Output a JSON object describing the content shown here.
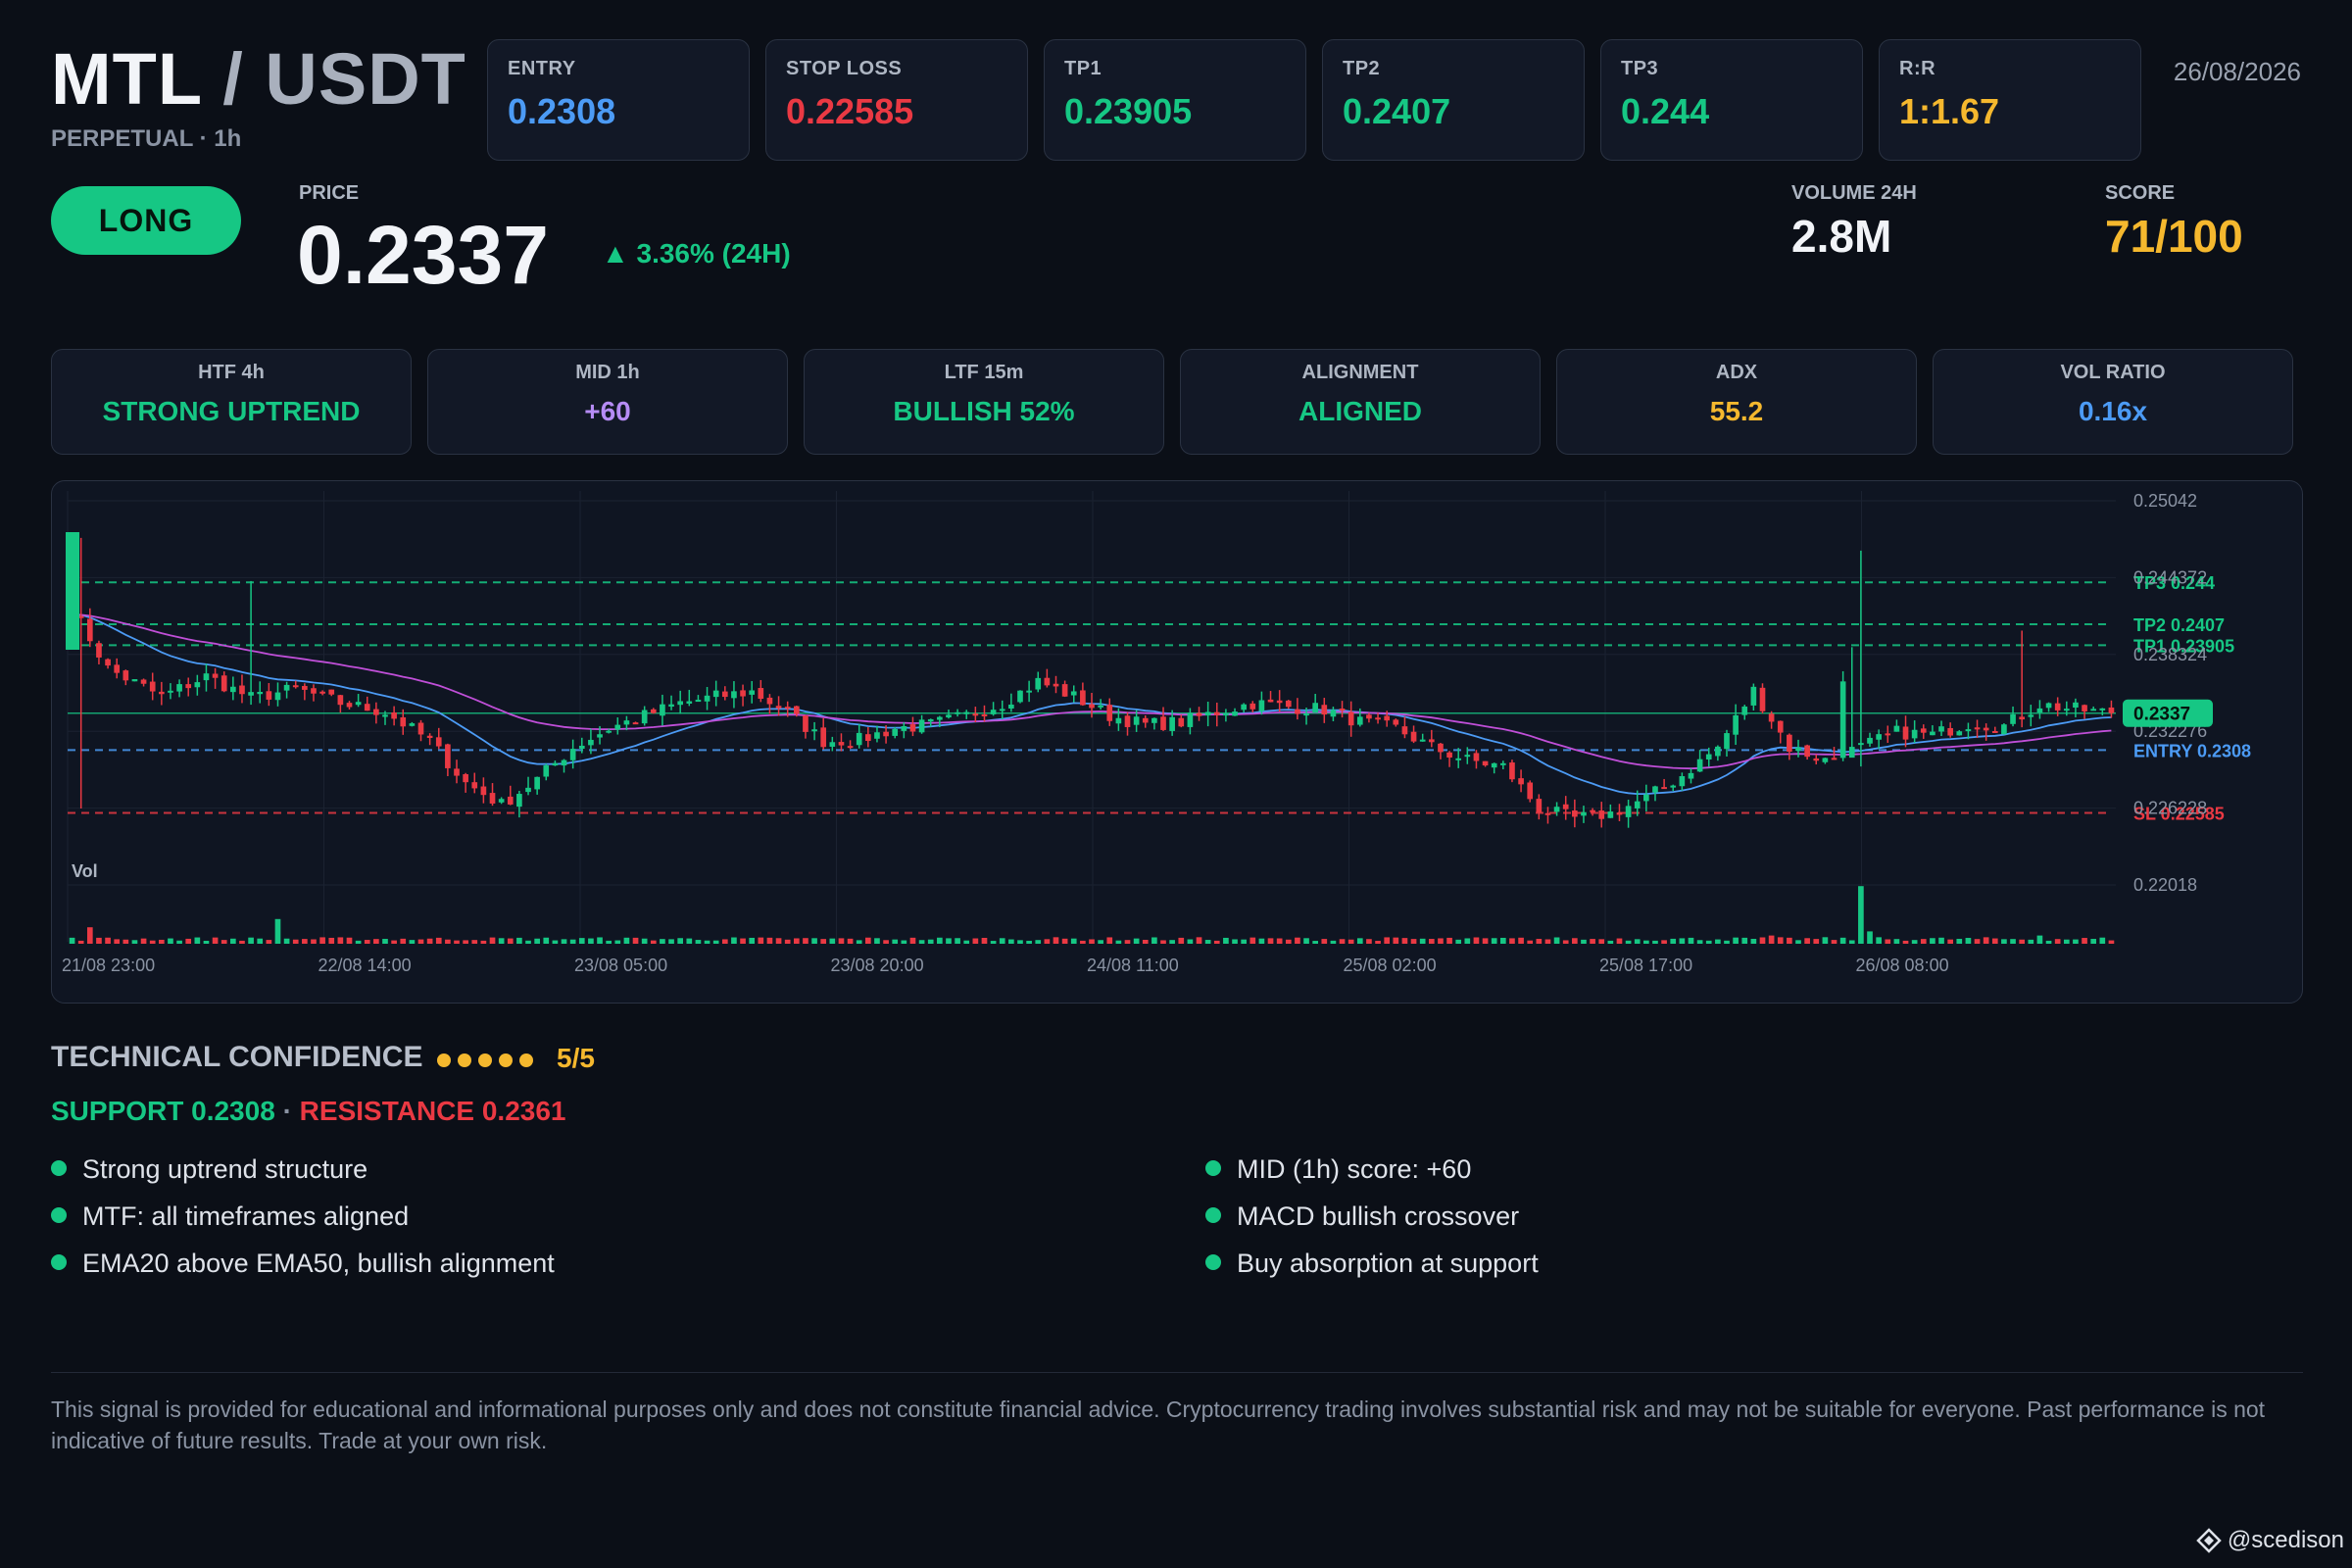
{
  "header": {
    "base": "MTL",
    "separator": "/",
    "quote": "USDT",
    "subtitle": "PERPETUAL · 1h",
    "date": "26/08/2026"
  },
  "metrics": [
    {
      "label": "ENTRY",
      "value": "0.2308",
      "color": "#4c9bf5"
    },
    {
      "label": "STOP LOSS",
      "value": "0.22585",
      "color": "#ea3943"
    },
    {
      "label": "TP1",
      "value": "0.23905",
      "color": "#16c784"
    },
    {
      "label": "TP2",
      "value": "0.2407",
      "color": "#16c784"
    },
    {
      "label": "TP3",
      "value": "0.244",
      "color": "#16c784"
    },
    {
      "label": "R:R",
      "value": "1:1.67",
      "color": "#f5b82e"
    }
  ],
  "signal": {
    "side": "LONG",
    "price_label": "PRICE",
    "price": "0.2337",
    "change": "▲ 3.36% (24H)",
    "volume_label": "VOLUME 24H",
    "volume": "2.8M",
    "score_label": "SCORE",
    "score": "71/100"
  },
  "timeframes": [
    {
      "label": "HTF 4h",
      "value": "STRONG UPTREND",
      "color": "#16c784"
    },
    {
      "label": "MID 1h",
      "value": "+60",
      "color": "#b68cf5"
    },
    {
      "label": "LTF 15m",
      "value": "BULLISH 52%",
      "color": "#16c784"
    },
    {
      "label": "ALIGNMENT",
      "value": "ALIGNED",
      "color": "#16c784"
    },
    {
      "label": "ADX",
      "value": "55.2",
      "color": "#f5b82e"
    },
    {
      "label": "VOL RATIO",
      "value": "0.16x",
      "color": "#4c9bf5"
    }
  ],
  "chart_data": {
    "type": "candlestick",
    "y_range": [
      0.22018,
      0.25042
    ],
    "y_ticks": [
      "0.25042",
      "0.244372",
      "0.238324",
      "0.232276",
      "0.226228",
      "0.22018"
    ],
    "x_ticks": [
      "21/08 23:00",
      "22/08 14:00",
      "23/08 05:00",
      "23/08 20:00",
      "24/08 11:00",
      "25/08 02:00",
      "25/08 17:00",
      "26/08 08:00"
    ],
    "volume_label": "Vol",
    "current_price_tag": "0.2337",
    "levels": [
      {
        "label": "TP3 0.244",
        "value": 0.244,
        "color": "#16c784"
      },
      {
        "label": "TP2 0.2407",
        "value": 0.2407,
        "color": "#16c784"
      },
      {
        "label": "TP1 0.23905",
        "value": 0.23905,
        "color": "#16c784"
      },
      {
        "label": "ENTRY 0.2308",
        "value": 0.2308,
        "color": "#4c9bf5"
      },
      {
        "label": "SL 0.22585",
        "value": 0.22585,
        "color": "#ea3943"
      }
    ],
    "current_price": 0.2337,
    "close_anchors": [
      [
        0,
        0.242
      ],
      [
        4,
        0.2372
      ],
      [
        10,
        0.235
      ],
      [
        15,
        0.2366
      ],
      [
        20,
        0.2349
      ],
      [
        25,
        0.2356
      ],
      [
        30,
        0.2345
      ],
      [
        35,
        0.2338
      ],
      [
        40,
        0.2315
      ],
      [
        44,
        0.2282
      ],
      [
        48,
        0.2265
      ],
      [
        52,
        0.2285
      ],
      [
        56,
        0.231
      ],
      [
        60,
        0.2325
      ],
      [
        64,
        0.2335
      ],
      [
        68,
        0.2345
      ],
      [
        72,
        0.235
      ],
      [
        76,
        0.2354
      ],
      [
        80,
        0.2338
      ],
      [
        84,
        0.2315
      ],
      [
        88,
        0.2316
      ],
      [
        92,
        0.2325
      ],
      [
        96,
        0.2328
      ],
      [
        100,
        0.2335
      ],
      [
        104,
        0.2345
      ],
      [
        108,
        0.2362
      ],
      [
        112,
        0.235
      ],
      [
        116,
        0.2335
      ],
      [
        120,
        0.2328
      ],
      [
        124,
        0.233
      ],
      [
        128,
        0.2338
      ],
      [
        132,
        0.2345
      ],
      [
        136,
        0.2342
      ],
      [
        140,
        0.234
      ],
      [
        144,
        0.233
      ],
      [
        148,
        0.2325
      ],
      [
        152,
        0.231
      ],
      [
        156,
        0.23
      ],
      [
        160,
        0.2295
      ],
      [
        164,
        0.2262
      ],
      [
        168,
        0.2254
      ],
      [
        172,
        0.2258
      ],
      [
        176,
        0.227
      ],
      [
        180,
        0.2288
      ],
      [
        184,
        0.231
      ],
      [
        188,
        0.2355
      ],
      [
        192,
        0.231
      ],
      [
        196,
        0.23
      ],
      [
        200,
        0.231
      ],
      [
        204,
        0.2322
      ],
      [
        208,
        0.232
      ],
      [
        212,
        0.2329
      ],
      [
        216,
        0.2327
      ],
      [
        220,
        0.2344
      ],
      [
        224,
        0.234
      ],
      [
        228,
        0.2337
      ]
    ],
    "volume_spikes": [
      [
        2,
        4
      ],
      [
        23,
        6
      ],
      [
        190,
        2
      ],
      [
        200,
        14
      ],
      [
        201,
        3
      ],
      [
        220,
        2
      ]
    ]
  },
  "confidence": {
    "title": "TECHNICAL CONFIDENCE",
    "dots": 5,
    "score": "5/5",
    "support": "SUPPORT 0.2308",
    "separator": "·",
    "resistance": "RESISTANCE 0.2361"
  },
  "reasons_left": [
    "Strong uptrend structure",
    "MTF: all timeframes aligned",
    "EMA20 above EMA50, bullish alignment"
  ],
  "reasons_right": [
    "MID (1h) score: +60",
    "MACD bullish crossover",
    "Buy absorption at support"
  ],
  "disclaimer": "This signal is provided for educational and informational purposes only and does not constitute financial advice. Cryptocurrency trading involves substantial risk and may not be suitable for everyone. Past performance is not indicative of future results. Trade at your own risk.",
  "watermark": "@scedison",
  "colors": {
    "bull": "#16c784",
    "bear": "#ea3943",
    "ema_fast": "#4c9bf5",
    "ema_slow": "#c04fd8",
    "grid": "#1b2231"
  }
}
